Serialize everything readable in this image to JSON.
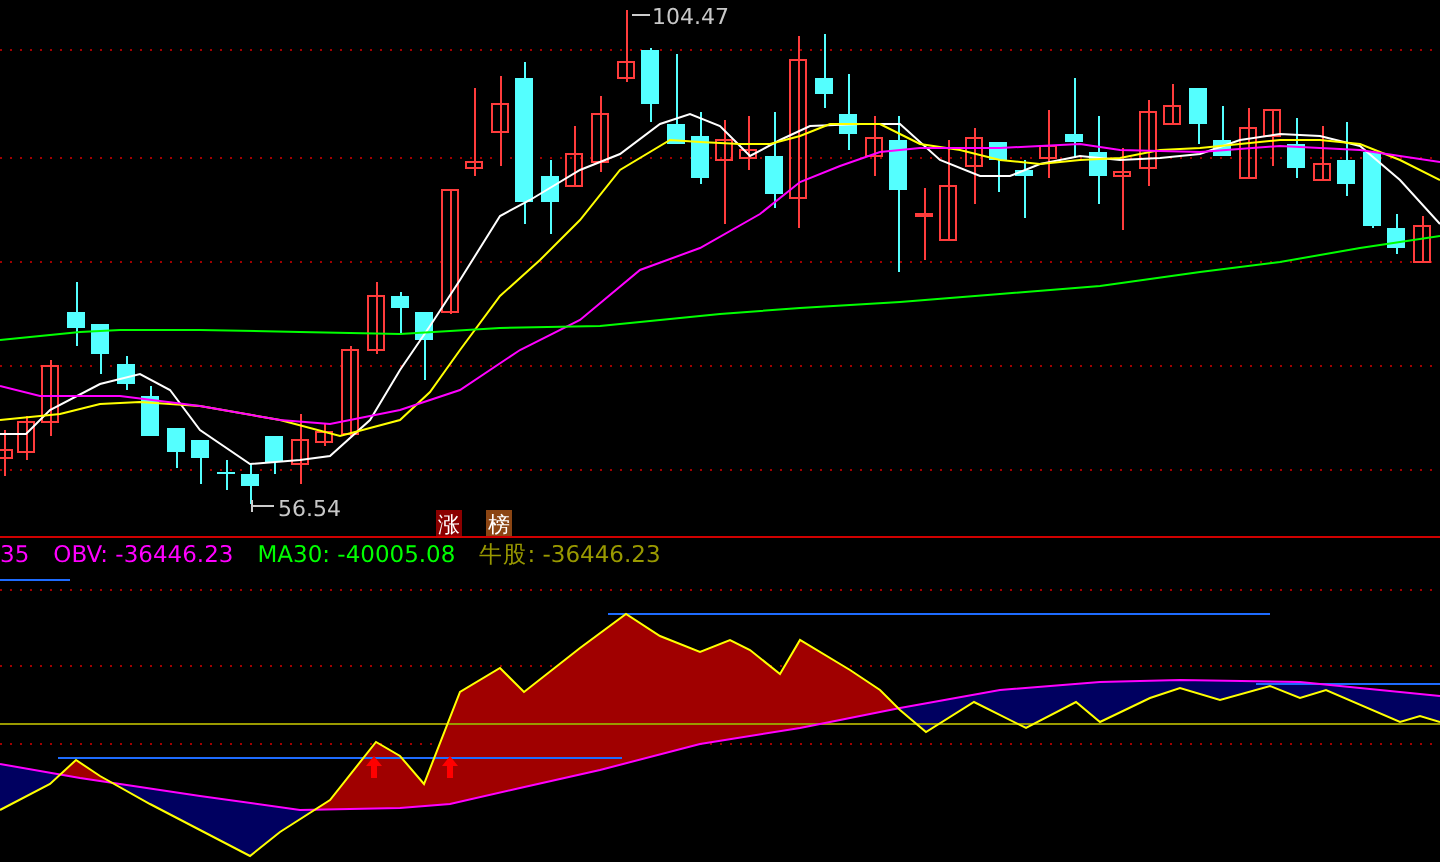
{
  "price_chart": {
    "high_label": "104.47",
    "low_label": "56.54",
    "badges": [
      {
        "text": "涨",
        "color": "#8b0000"
      },
      {
        "text": "榜",
        "color": "#8b4513"
      }
    ]
  },
  "indicator": {
    "legend": [
      {
        "text": "35",
        "color": "#ff00ff"
      },
      {
        "text": "OBV: -36446.23",
        "color": "#ff00ff"
      },
      {
        "text": "MA30: -40005.08",
        "color": "#00ff00"
      },
      {
        "text": "牛股: -36446.23",
        "color": "#999900"
      }
    ]
  }
}
